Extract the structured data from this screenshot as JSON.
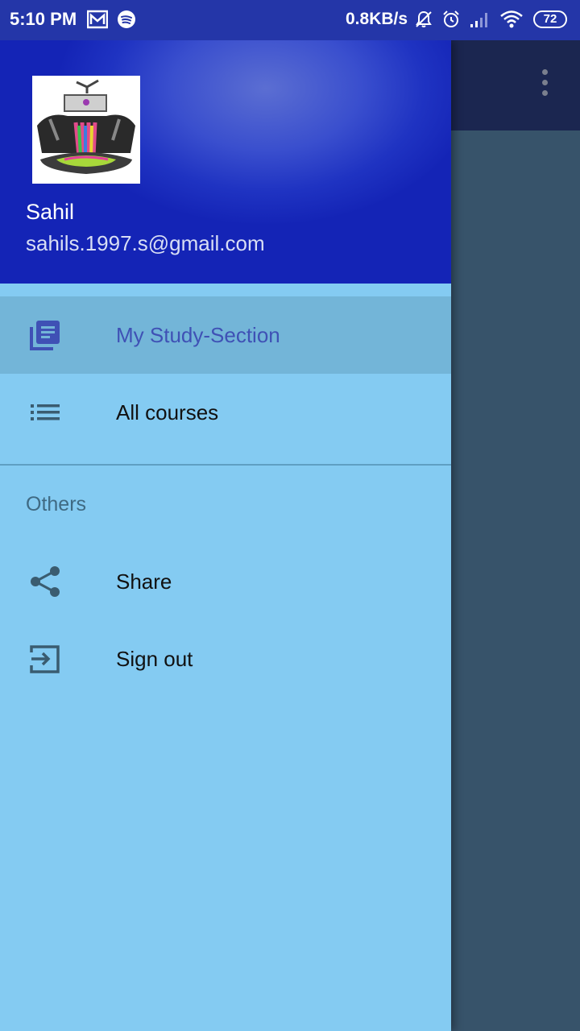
{
  "status_bar": {
    "time": "5:10 PM",
    "net_speed": "0.8KB/s",
    "battery": "72",
    "icons": [
      "gmail-icon",
      "spotify-icon",
      "mute-icon",
      "alarm-icon",
      "signal-icon",
      "wifi-icon",
      "battery-icon"
    ]
  },
  "drawer": {
    "header": {
      "user_name": "Sahil",
      "user_email": "sahils.1997.s@gmail.com"
    },
    "items": [
      {
        "label": "My Study-Section",
        "icon": "library-books-icon",
        "active": true
      },
      {
        "label": "All courses",
        "icon": "list-icon",
        "active": false
      }
    ],
    "section_title": "Others",
    "other_items": [
      {
        "label": "Share",
        "icon": "share-icon"
      },
      {
        "label": "Sign out",
        "icon": "sign-out-icon"
      }
    ]
  },
  "colors": {
    "status_bar": "#2436a8",
    "drawer_bg": "#84cbf2",
    "active_item_bg": "#73b5d8",
    "active_text": "#3f51b5",
    "app_bar": "#1b2650",
    "scrim": "#37536a"
  }
}
